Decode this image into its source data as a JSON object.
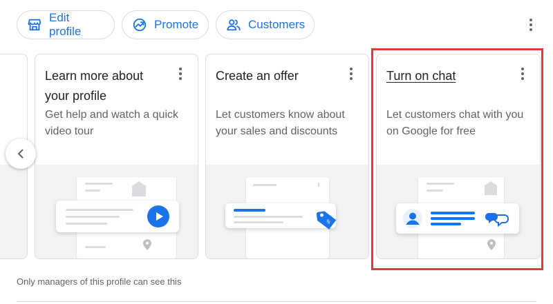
{
  "toolbar": {
    "edit_profile": "Edit profile",
    "promote": "Promote",
    "customers": "Customers"
  },
  "cards": [
    {
      "title": "Learn more about your profile",
      "desc": "Get help and watch a quick video tour"
    },
    {
      "title": "Create an offer",
      "desc": "Let customers know about your sales and discounts"
    },
    {
      "title": "Turn on chat",
      "desc": "Let customers chat with you on Google for free"
    }
  ],
  "footer": {
    "note": "Only managers of this profile can see this"
  },
  "colors": {
    "accent": "#1a73e8",
    "highlight": "#e53935",
    "border": "#dadce0",
    "secondary_text": "#5f6368"
  },
  "icons": [
    "storefront-icon",
    "trending-up-icon",
    "people-icon",
    "more-vert-icon",
    "chevron-left-icon",
    "play-icon",
    "tag-icon",
    "chat-bubbles-icon",
    "person-icon",
    "map-pin-icon"
  ]
}
